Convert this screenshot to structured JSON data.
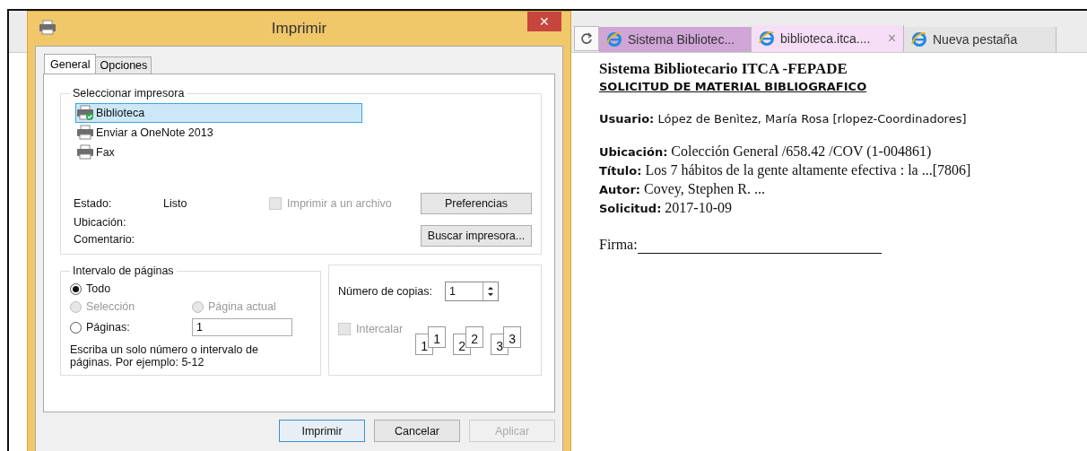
{
  "browser": {
    "tabs": [
      {
        "label": "Sistema Bibliotec...",
        "selected": false,
        "closable": false,
        "color": "#cfa6d6"
      },
      {
        "label": "biblioteca.itca....",
        "selected": true,
        "closable": true,
        "color": "#f6def6"
      },
      {
        "label": "Nueva pestaña",
        "selected": false,
        "closable": false,
        "color": "#e4e4e4"
      }
    ],
    "close_glyph": "×",
    "document": {
      "title": "Sistema Bibliotecario ITCA -FEPADE",
      "subtitle": "SOLICITUD DE MATERIAL BIBLIOGRAFICO",
      "user": {
        "label": "Usuario:",
        "value": "López de Benìtez, María Rosa [rlopez-Coordinadores]"
      },
      "fields": [
        {
          "label": "Ubicación:",
          "value": "Colección General /658.42 /COV (1-004861)"
        },
        {
          "label": "Título:",
          "value": "Los 7 hábitos de la gente altamente efectiva : la ...[7806]"
        },
        {
          "label": "Autor:",
          "value": "Covey, Stephen R. ..."
        },
        {
          "label": "Solicitud:",
          "value": "2017-10-09"
        }
      ],
      "signature": "Firma:"
    }
  },
  "dialog": {
    "title": "Imprimir",
    "close_glyph": "✕",
    "tabs": [
      {
        "label": "General",
        "selected": true
      },
      {
        "label": "Opciones",
        "selected": false
      }
    ],
    "printer_group": {
      "legend": "Seleccionar impresora",
      "printers": [
        {
          "name": "Biblioteca",
          "selected": true,
          "default": true
        },
        {
          "name": "Enviar a OneNote 2013",
          "selected": false,
          "default": false
        },
        {
          "name": "Fax",
          "selected": false,
          "default": false
        }
      ],
      "status": [
        {
          "label": "Estado:",
          "value": "Listo"
        },
        {
          "label": "Ubicación:"
        },
        {
          "label": "Comentario:"
        }
      ],
      "print_to_file": {
        "label": "Imprimir a un archivo",
        "checked": false,
        "disabled": true
      },
      "buttons": [
        "Preferencias",
        "Buscar impresora..."
      ]
    },
    "range_group": {
      "legend": "Intervalo de páginas",
      "options": [
        {
          "label": "Todo",
          "selected": true,
          "disabled": false
        },
        {
          "label": "Selección",
          "selected": false,
          "disabled": true
        },
        {
          "label": "Página actual",
          "selected": false,
          "disabled": true
        },
        {
          "label": "Páginas:",
          "selected": false,
          "disabled": false
        }
      ],
      "pages_value": "1",
      "hint": "Escriba un solo número o intervalo de páginas. Por ejemplo: 5-12"
    },
    "copies_group": {
      "label": "Número de copias:",
      "value": "1",
      "collate": {
        "label": "Intercalar",
        "checked": false,
        "disabled": true
      },
      "stacks": [
        {
          "front": "1",
          "back": "1"
        },
        {
          "front": "2",
          "back": "2"
        },
        {
          "front": "3",
          "back": "3"
        }
      ]
    },
    "buttons": [
      {
        "label": "Imprimir",
        "default": true,
        "disabled": false
      },
      {
        "label": "Cancelar",
        "default": false,
        "disabled": false
      },
      {
        "label": "Aplicar",
        "default": false,
        "disabled": true
      }
    ]
  }
}
